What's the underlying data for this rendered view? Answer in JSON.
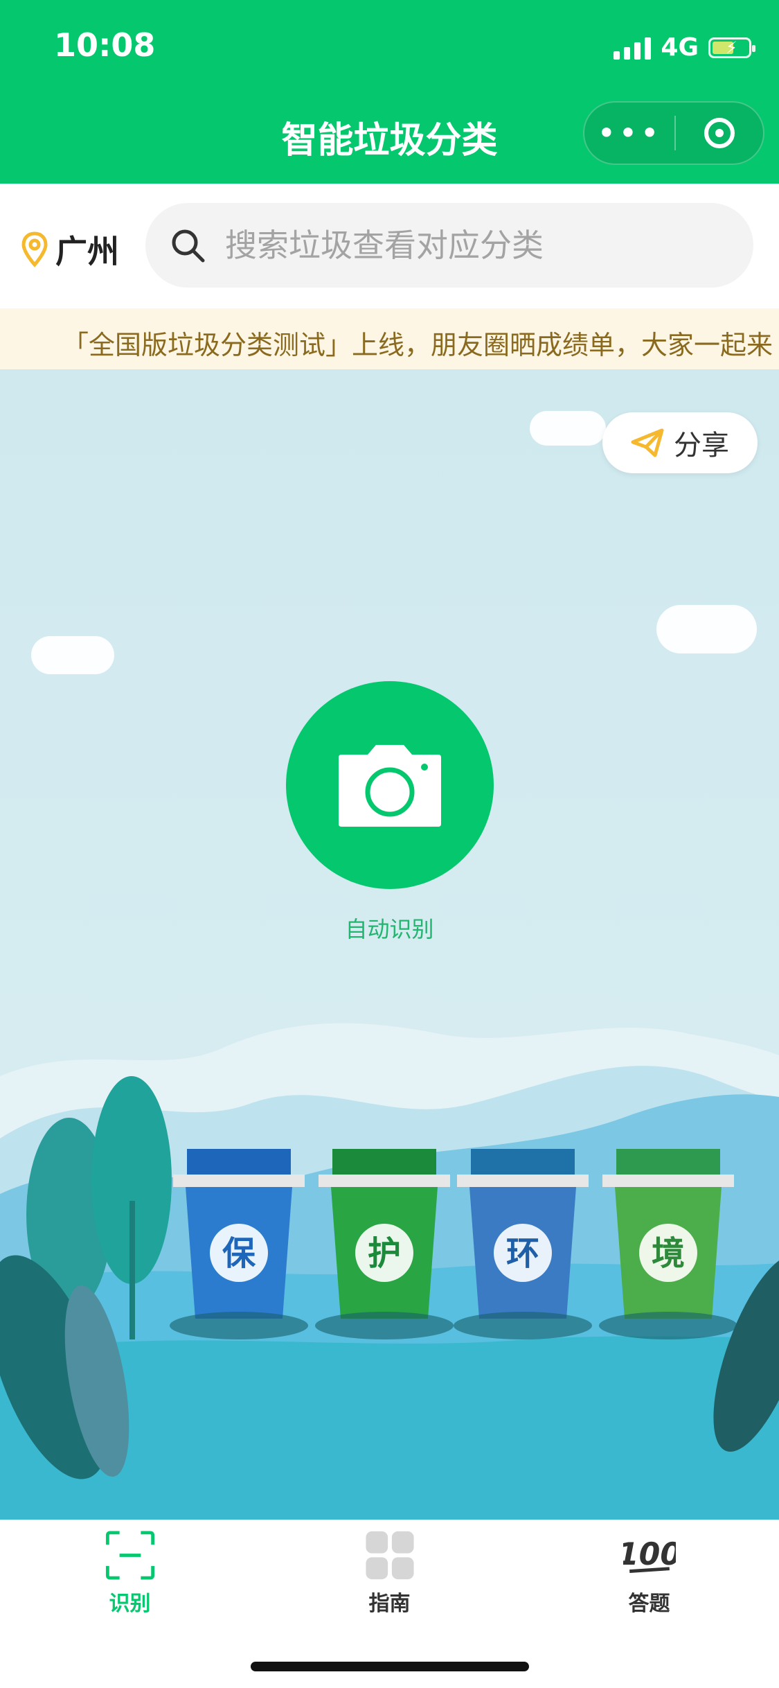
{
  "status_bar": {
    "time": "10:08",
    "network": "4G"
  },
  "nav": {
    "title": "智能垃圾分类",
    "more_icon": "more-dots-icon",
    "close_icon": "target-icon"
  },
  "search": {
    "city": "广州",
    "placeholder": "搜索垃圾查看对应分类"
  },
  "notice": {
    "text": "「全国版垃圾分类测试」上线，朋友圈晒成绩单，大家一起来"
  },
  "share": {
    "label": "分享"
  },
  "camera": {
    "label": "自动识别"
  },
  "bins": [
    "保",
    "护",
    "环",
    "境"
  ],
  "tabs": [
    {
      "label": "识别",
      "icon": "scan-icon"
    },
    {
      "label": "指南",
      "icon": "grid-icon"
    },
    {
      "label": "答题",
      "icon": "hundred-icon"
    }
  ],
  "colors": {
    "brand": "#05c76e",
    "active_tab": "#05c76e",
    "notice_text": "#8a6a1e"
  }
}
